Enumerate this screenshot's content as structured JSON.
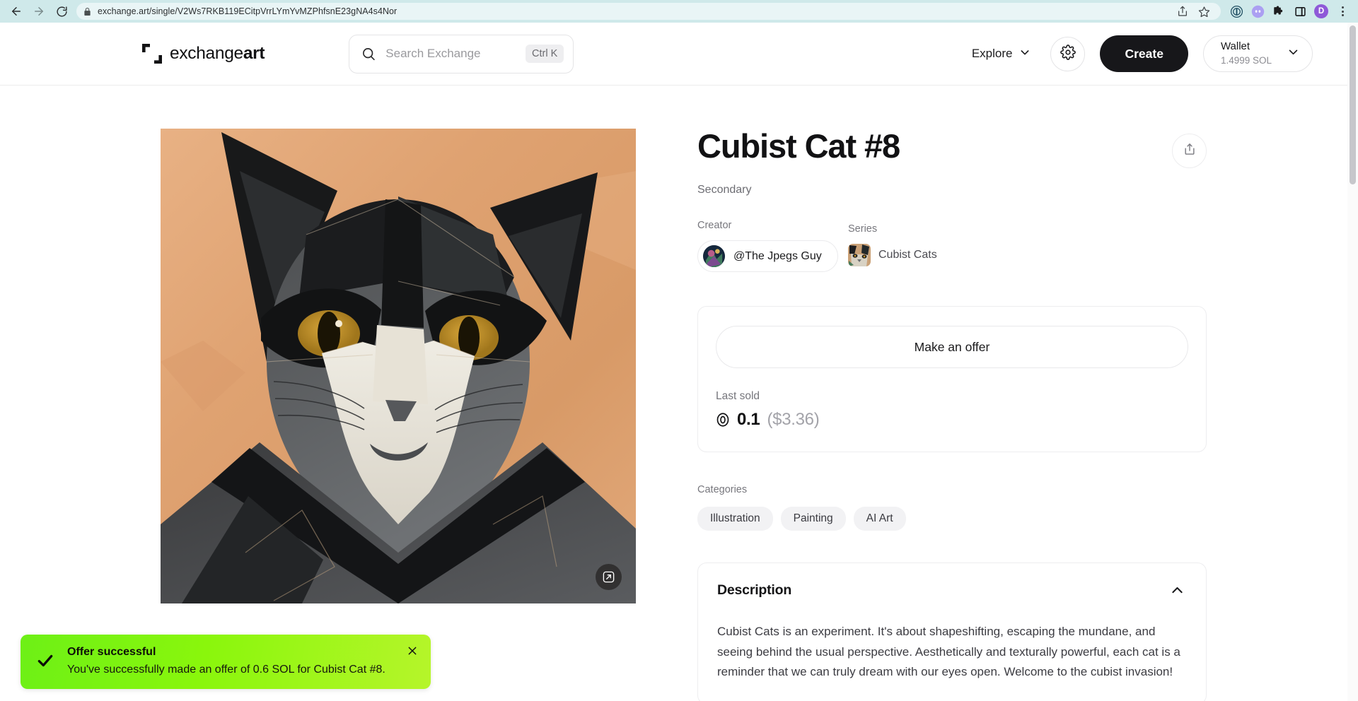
{
  "browser": {
    "url": "exchange.art/single/V2Ws7RKB119ECitpVrrLYmYvMZPhfsnE23gNA4s4Nor",
    "back_label": "Back",
    "forward_label": "Forward",
    "reload_label": "Reload",
    "lock_label": "Site information",
    "share_label": "Share this page",
    "bookmark_label": "Bookmark this tab",
    "profile_initial": "D",
    "menu_label": "Customize and control",
    "extensions_label": "Extensions",
    "sidepanel_label": "Side panel"
  },
  "header": {
    "logo_text_regular": "exchange",
    "logo_text_bold": "art",
    "search": {
      "placeholder": "Search Exchange",
      "shortcut": "Ctrl K"
    },
    "explore_label": "Explore",
    "settings_label": "Settings",
    "create_label": "Create",
    "wallet": {
      "label": "Wallet",
      "balance": "1.4999 SOL"
    }
  },
  "artwork": {
    "expand_label": "Expand artwork",
    "alt": "Cubist Cat #8 painting"
  },
  "detail": {
    "title": "Cubist Cat #8",
    "market_type": "Secondary",
    "share_label": "Share",
    "creator": {
      "label": "Creator",
      "name": "@The Jpegs Guy"
    },
    "series": {
      "label": "Series",
      "name": "Cubist Cats"
    },
    "offer": {
      "button_label": "Make an offer",
      "last_sold_label": "Last sold",
      "price_sol": "0.1",
      "price_usd": "($3.36)"
    },
    "categories": {
      "label": "Categories",
      "items": [
        "Illustration",
        "Painting",
        "AI Art"
      ]
    },
    "description": {
      "title": "Description",
      "collapse_label": "Collapse",
      "body": "Cubist Cats is an experiment. It's about shapeshifting, escaping the mundane, and seeing behind the usual perspective. Aesthetically and texturally powerful, each cat is a reminder that we can truly dream with our eyes open.\nWelcome to the cubist invasion!"
    }
  },
  "toast": {
    "title": "Offer successful",
    "message": "You've successfully made an offer of 0.6 SOL for Cubist Cat #8.",
    "close_label": "Dismiss",
    "accent_start": "#6df016",
    "accent_end": "#b6f52a"
  },
  "colors": {
    "brand_dark": "#17171a",
    "browser_chrome": "#cfe9ea",
    "muted_text": "#76767c",
    "pill_bg": "#f2f2f4",
    "profile_purple": "#8e59d8"
  }
}
